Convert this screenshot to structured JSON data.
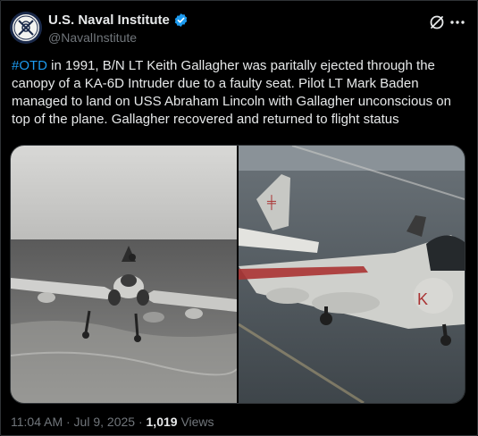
{
  "author": {
    "display_name": "U.S. Naval Institute",
    "handle": "@NavalInstitute",
    "verified": true
  },
  "icons": {
    "avatar": "naval-institute-seal-icon",
    "verified": "verified-badge-icon",
    "grok": "grok-icon",
    "more": "more-options-icon"
  },
  "tweet": {
    "hashtag": "#OTD",
    "body": " in 1991, B/N LT Keith Gallagher was paritally ejected through the canopy of a KA-6D Intruder due to a faulty seat. Pilot LT Mark Baden managed to land on USS Abraham Lincoln with Gallagher unconscious on top of the plane. Gallagher recovered and returned to flight status"
  },
  "media": {
    "photos": [
      {
        "description": "black-and-white photo of an Intruder landing over the sea"
      },
      {
        "description": "color photo of the Intruder on the carrier deck"
      }
    ]
  },
  "meta": {
    "timestamp": "11:04 AM · Jul 9, 2025",
    "separator": " · ",
    "views_count": "1,019",
    "views_label": " Views"
  },
  "colors": {
    "accent": "#1d9bf0",
    "text": "#e7e9ea",
    "secondary": "#71767b",
    "border": "#2f3336"
  }
}
